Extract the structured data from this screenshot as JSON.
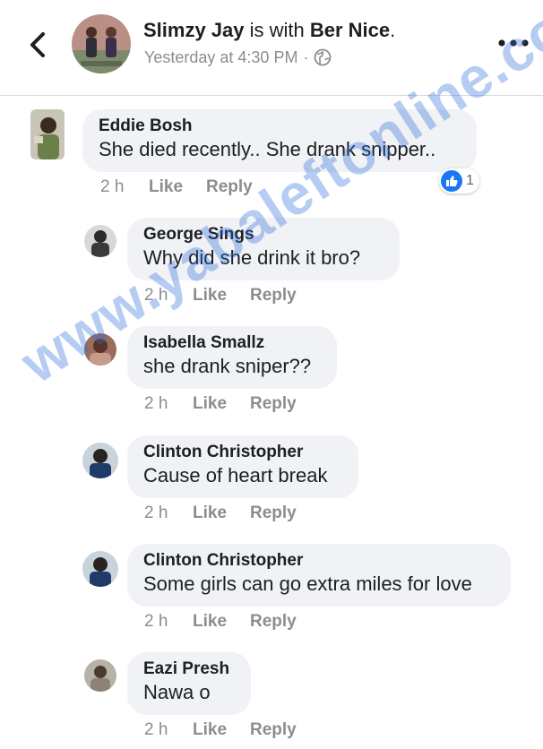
{
  "post": {
    "author": "Slimzy Jay",
    "with_text": " is with ",
    "tagged": "Ber Nice",
    "period": ".",
    "timestamp": "Yesterday at 4:30 PM",
    "meta_separator": "·",
    "privacy_icon": "globe-icon",
    "back_icon": "chevron-left-icon",
    "more_icon": "more-horizontal-icon"
  },
  "comments": [
    {
      "author": "Eddie Bosh",
      "text": "She died recently.. She drank snipper..",
      "time": "2 h",
      "like": "Like",
      "reply": "Reply",
      "reaction_count": "1"
    },
    {
      "author": "George Sings",
      "text": "Why did she drink  it bro?",
      "time": "2 h",
      "like": "Like",
      "reply": "Reply"
    },
    {
      "author": "Isabella Smallz",
      "text": "she drank sniper??",
      "time": "2 h",
      "like": "Like",
      "reply": "Reply"
    },
    {
      "author": "Clinton Christopher",
      "text": "Cause of heart break",
      "time": "2 h",
      "like": "Like",
      "reply": "Reply"
    },
    {
      "author": "Clinton Christopher",
      "text": "Some girls can go extra miles for love",
      "time": "2 h",
      "like": "Like",
      "reply": "Reply"
    },
    {
      "author": "Eazi Presh",
      "text": "Nawa o",
      "time": "2 h",
      "like": "Like",
      "reply": "Reply"
    }
  ],
  "watermark": "www.yabaleftonline.com",
  "colors": {
    "bubble": "#f0f2f5",
    "meta_text": "#8a8d91",
    "like_blue": "#1877f2",
    "watermark": "#2d6edc"
  }
}
